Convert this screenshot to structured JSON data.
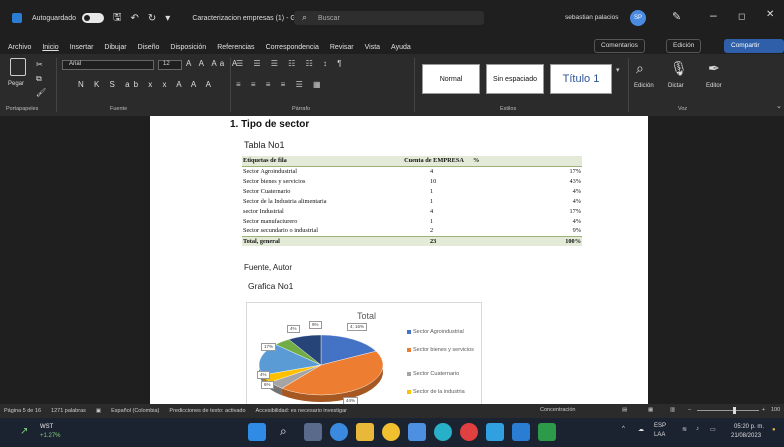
{
  "titlebar": {
    "autosave_label": "Autoguardado",
    "document_title": "Caracterizacion empresas (1) - Guardado ∨",
    "search_placeholder": "Buscar",
    "user_name": "sebastian palacios",
    "user_initials": "SP"
  },
  "menu": {
    "items": [
      "Archivo",
      "Inicio",
      "Insertar",
      "Dibujar",
      "Diseño",
      "Disposición",
      "Referencias",
      "Correspondencia",
      "Revisar",
      "Vista",
      "Ayuda"
    ],
    "comments": "Comentarios",
    "editing": "Edición",
    "share": "Compartir"
  },
  "ribbon": {
    "paste_label": "Pegar",
    "font_name": "Arial",
    "font_size": "12",
    "groups": {
      "clipboard": "Portapapeles",
      "font": "Fuente",
      "paragraph": "Párrafo",
      "styles": "Estilos",
      "voice": "Voz"
    },
    "styles": [
      "Normal",
      "Sin espaciado",
      "Título 1"
    ],
    "edit_label": "Edición",
    "dictate_label": "Dictar",
    "editor_label": "Editor"
  },
  "document": {
    "heading": "1.  Tipo de sector",
    "table_title": "Tabla No1",
    "table": {
      "headers": [
        "Etiquetas de fila",
        "Cuenta de EMPRESA",
        "%"
      ],
      "rows": [
        [
          "Sector Agroindustrial",
          "4",
          "17%"
        ],
        [
          "Sector bienes y servicios",
          "10",
          "43%"
        ],
        [
          "Sector Cuaternario",
          "1",
          "4%"
        ],
        [
          "Sector de la Industria alimentaria",
          "1",
          "4%"
        ],
        [
          "sector Industrial",
          "4",
          "17%"
        ],
        [
          "Sector manufacturero",
          "1",
          "4%"
        ],
        [
          "Sector secundario o industrial",
          "2",
          "9%"
        ]
      ],
      "total": [
        "Total, general",
        "23",
        "100%"
      ]
    },
    "source": "Fuente, Autor",
    "chart_heading": "Grafica No1"
  },
  "chart_data": {
    "type": "pie",
    "title": "Total",
    "categories": [
      "Sector Agroindustrial",
      "Sector bienes y servicios",
      "Sector Cuaternario",
      "Sector de la Industria alimentaria",
      "sector Industrial",
      "Sector manufacturero",
      "Sector secundario o industrial"
    ],
    "values": [
      4,
      10,
      1,
      1,
      4,
      1,
      2
    ],
    "data_labels": [
      "4; 16%",
      "9%",
      "4%",
      "17%",
      "4%",
      "6%",
      "44%"
    ],
    "legend_visible": [
      "Sector Agroindustrial",
      "Sector bienes y servicios",
      "Sector Cuaternario",
      "Sector de la industria"
    ],
    "legend_position": "right",
    "colors": [
      "#4472c4",
      "#ed7d31",
      "#a5a5a5",
      "#ffc000",
      "#5b9bd5",
      "#70ad47",
      "#264478"
    ]
  },
  "statusbar": {
    "page": "Página 5 de 16",
    "words": "1271 palabras",
    "language": "Español (Colombia)",
    "predictions": "Predicciones de texto: activado",
    "accessibility": "Accesibilidad: es necesario investigar",
    "focus": "Concentración",
    "zoom": "100"
  },
  "taskbar": {
    "weather_name": "WST",
    "weather_change": "+1.27%",
    "lang_top": "ESP",
    "lang_bottom": "LAA",
    "time": "05:20 p. m.",
    "date": "21/08/2023"
  }
}
